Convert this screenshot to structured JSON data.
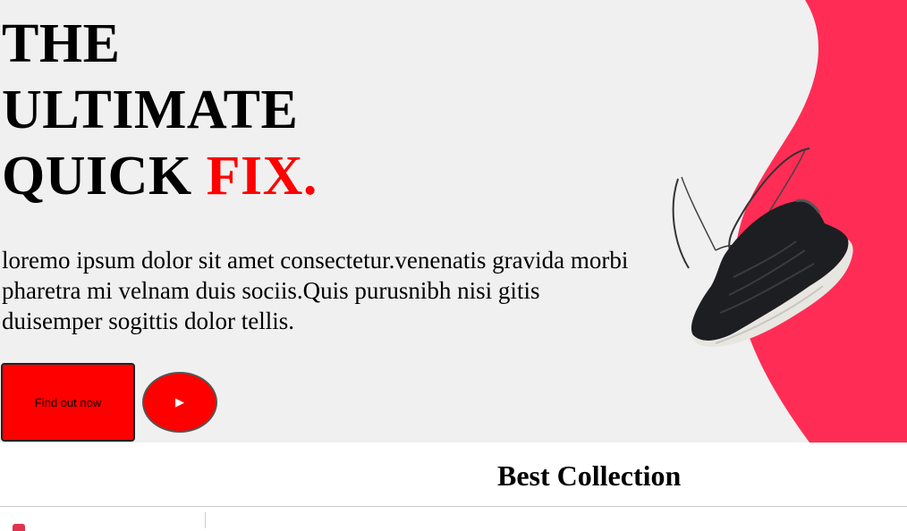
{
  "hero": {
    "title_line1": "THE",
    "title_line2": "ULTIMATE",
    "title_line3_prefix": "QUICK ",
    "title_line3_accent": "FIX.",
    "description": "loremo ipsum dolor sit amet consectetur.venenatis gravida morbi pharetra mi velnam duis sociis.Quis purusnibh nisi gitis duisemper sogittis dolor tellis.",
    "cta_label": "Find out now",
    "play_icon": "▶",
    "accent_color": "#ff0000",
    "wave_color": "#ff2d55",
    "background_color": "#f0f0f0"
  },
  "collection": {
    "title": "Best Collection"
  },
  "icons": {
    "play": "play-icon",
    "shoe": "sneaker-image"
  }
}
